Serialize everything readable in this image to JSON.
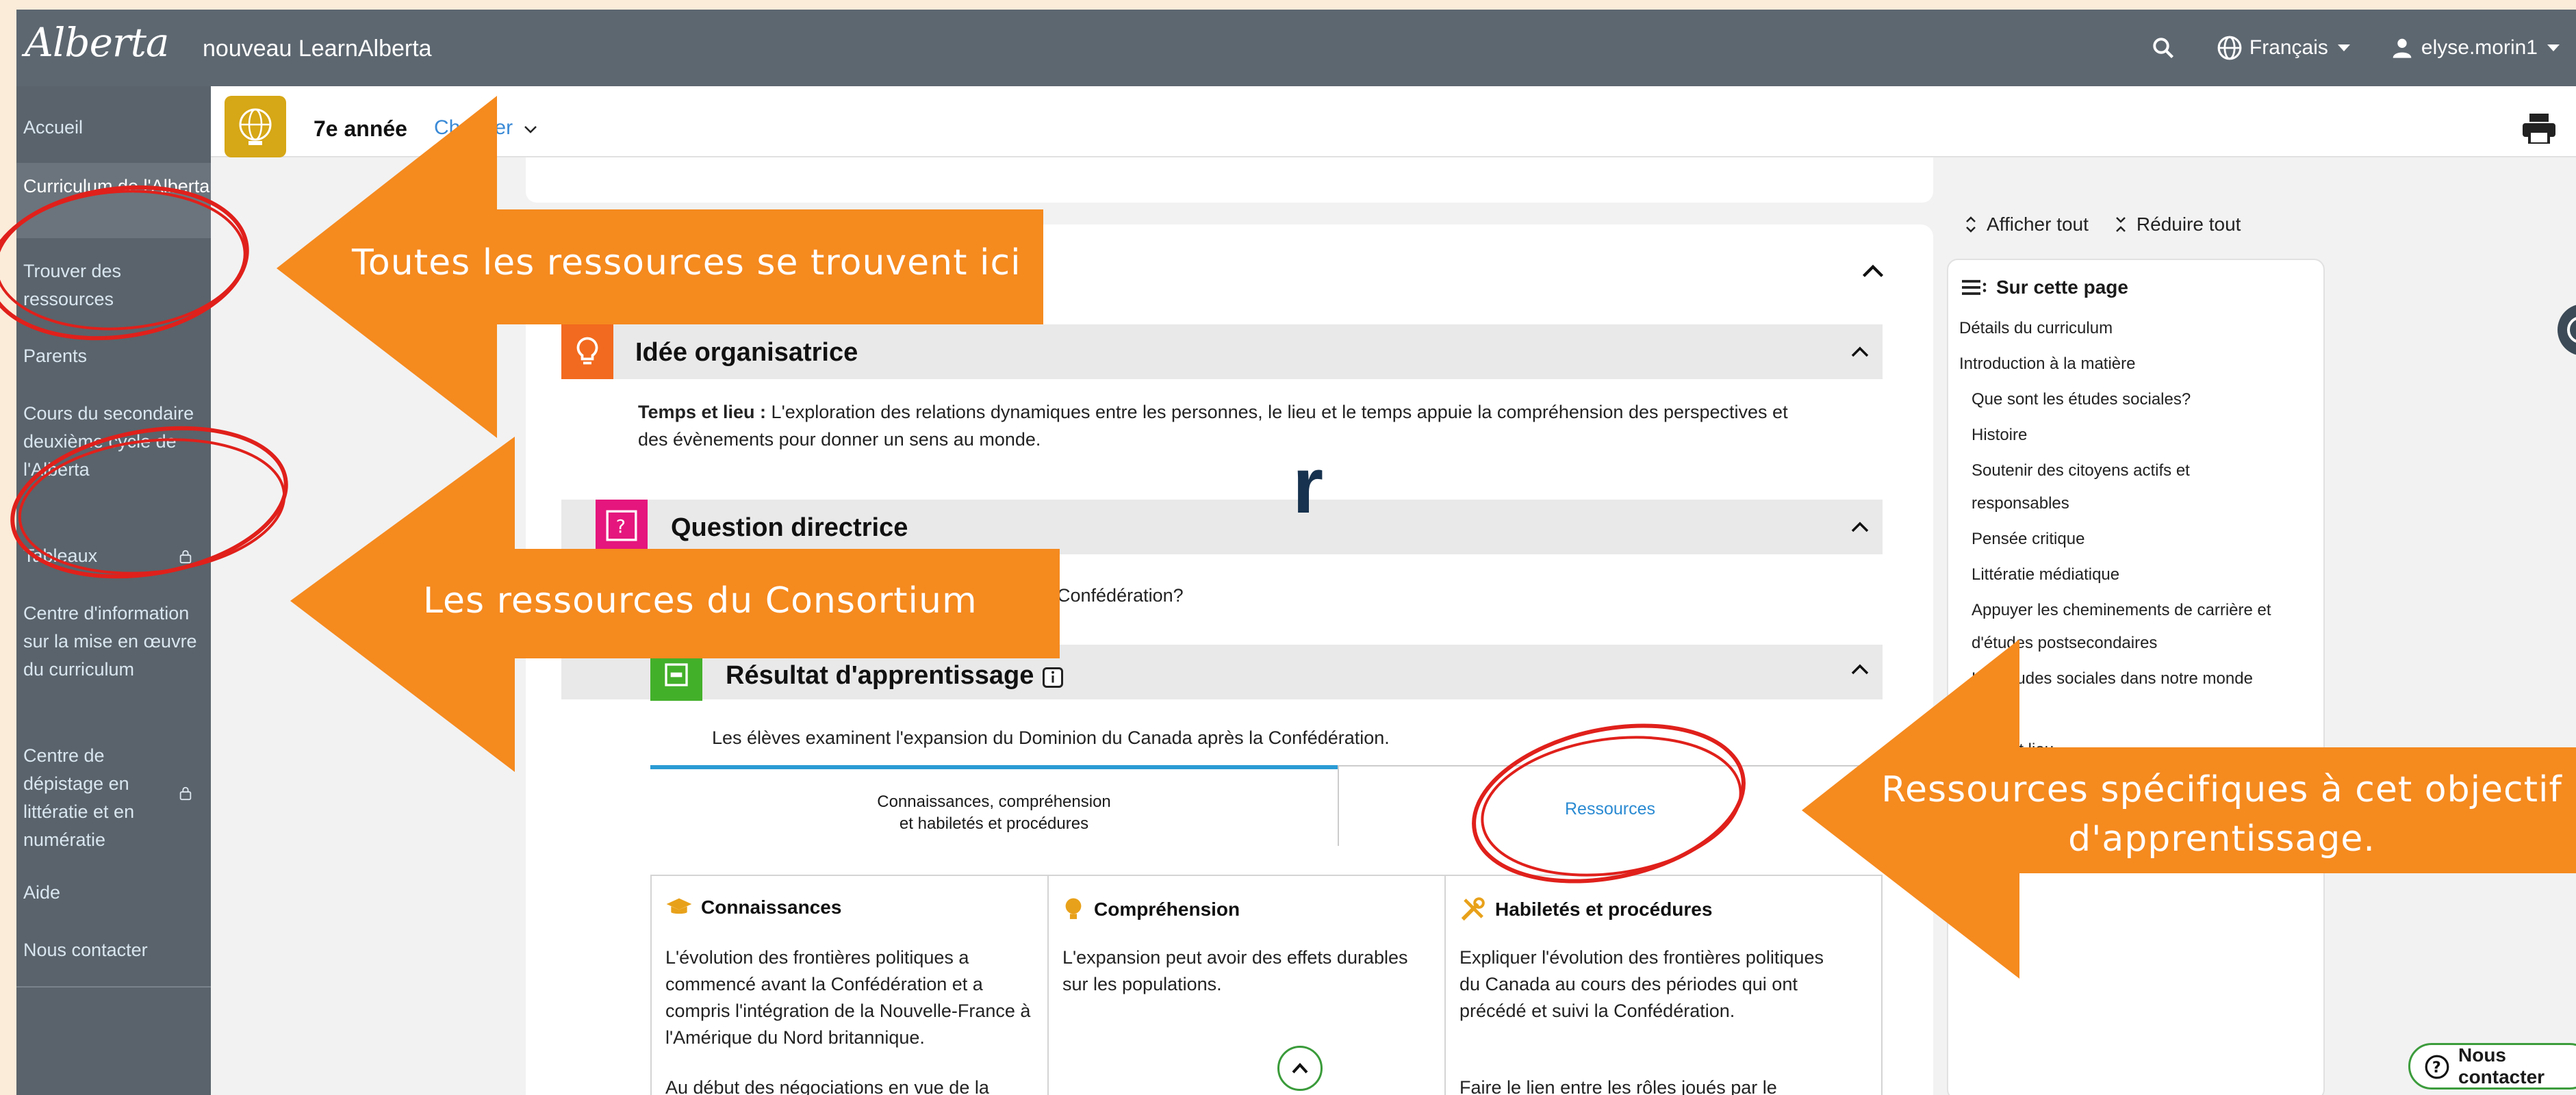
{
  "header": {
    "logo_text": "Alberta",
    "site_title": "nouveau LearnAlberta",
    "language": "Français",
    "user": "elyse.morin1"
  },
  "sidebar": {
    "items": [
      {
        "label": "Accueil"
      },
      {
        "label": "Curriculum de l'Alberta",
        "active": true
      },
      {
        "label": "Trouver des ressources"
      },
      {
        "label": "Parents"
      },
      {
        "label": "Cours du secondaire deuxième cycle de l'Alberta"
      },
      {
        "label": "Tableaux",
        "locked": true
      },
      {
        "label": "Centre d'information sur la mise en œuvre du curriculum"
      },
      {
        "label": "Centre de dépistage en littératie et en numératie",
        "locked": true
      },
      {
        "label": "Aide"
      },
      {
        "label": "Nous contacter"
      }
    ]
  },
  "course": {
    "grade": "7e année",
    "change_link": "Changer"
  },
  "sections": {
    "idee": {
      "title": "Idée organisatrice",
      "lead": "Temps et lieu :",
      "text": " L'exploration des relations dynamiques entre les personnes, le lieu et le temps appuie la compréhension des perspectives et des évènements pour donner un sens au monde."
    },
    "question": {
      "title": "Question directrice",
      "text": "Confédération?"
    },
    "resultat": {
      "title": "Résultat d'apprentissage",
      "text": "Les élèves examinent l'expansion du Dominion du Canada après la Confédération."
    }
  },
  "tabs": {
    "left_line1": "Connaissances, compréhension",
    "left_line2": "et habiletés et procédures",
    "right": "Ressources"
  },
  "columns": [
    {
      "title": "Connaissances",
      "text": "L'évolution des frontières politiques a commencé avant la Confédération et a compris l'intégration de la Nouvelle-France à l'Amérique du Nord britannique.",
      "text2": "Au début des négociations en vue de la"
    },
    {
      "title": "Compréhension",
      "text": "L'expansion peut avoir des effets durables sur les populations."
    },
    {
      "title": "Habiletés et procédures",
      "text": "Expliquer l'évolution des frontières politiques du Canada au cours des périodes qui ont précédé et suivi la Confédération.",
      "text2": "Faire le lien entre les rôles joués par le"
    }
  ],
  "right_panel": {
    "show_all": "Afficher tout",
    "collapse_all": "Réduire tout",
    "on_page_title": "Sur cette page",
    "items": [
      "Détails du curriculum",
      "Introduction à la matière",
      "Que sont les études sociales?",
      "Histoire",
      "Soutenir des citoyens actifs et",
      "responsables",
      "Pensée critique",
      "Littératie médiatique",
      "Appuyer les cheminements de carrière et",
      "d'études postsecondaires",
      "Les études sociales dans notre monde",
      "et lieu"
    ]
  },
  "contact_button": "Nous contacter",
  "annotations": {
    "callout1": "Toutes les ressources se trouvent ici",
    "callout2": "Les ressources du Consortium",
    "callout3_line1": "Ressources spécifiques à cet objectif",
    "callout3_line2": "d'apprentissage.",
    "stray_letter": "r",
    "arrow_color": "#f58a1f",
    "circle_color": "#e0201b"
  }
}
